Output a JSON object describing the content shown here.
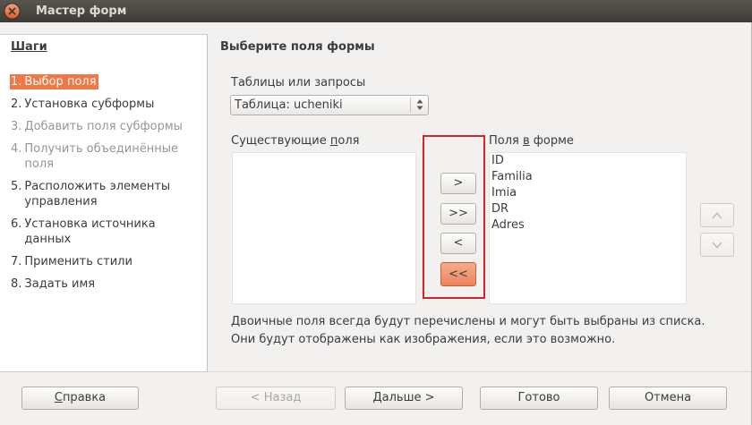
{
  "window": {
    "title": "Мастер форм",
    "close_icon": "close-icon"
  },
  "colors": {
    "accent": "#f07746",
    "annotation": "#d42426",
    "disabled_text": "#979592"
  },
  "steps": {
    "heading": "Шаги",
    "items": [
      {
        "number": "1.",
        "lines": [
          "Выбор поля"
        ],
        "selected": true,
        "enabled": true
      },
      {
        "number": "2.",
        "lines": [
          "Установка субформы"
        ],
        "selected": false,
        "enabled": true
      },
      {
        "number": "3.",
        "lines": [
          "Добавить поля субформы"
        ],
        "selected": false,
        "enabled": false
      },
      {
        "number": "4.",
        "lines": [
          "Получить объединённые",
          "поля"
        ],
        "selected": false,
        "enabled": false
      },
      {
        "number": "5.",
        "lines": [
          "Расположить элементы",
          "управления"
        ],
        "selected": false,
        "enabled": true
      },
      {
        "number": "6.",
        "lines": [
          "Установка источника",
          "данных"
        ],
        "selected": false,
        "enabled": true
      },
      {
        "number": "7.",
        "lines": [
          "Применить стили"
        ],
        "selected": false,
        "enabled": true
      },
      {
        "number": "8.",
        "lines": [
          "Задать имя"
        ],
        "selected": false,
        "enabled": true
      }
    ]
  },
  "page": {
    "title": "Выберите поля формы",
    "tables_label": "Таблицы или запросы",
    "table_select": {
      "value": "Таблица: ucheniki",
      "icon": "combo-arrows-icon"
    },
    "existing_fields": {
      "label_before": "Существующие ",
      "label_key": "п",
      "label_after": "оля",
      "items": []
    },
    "form_fields": {
      "label_before": "Поля ",
      "label_key": "в",
      "label_after": " форме",
      "items": [
        "ID",
        "Familia",
        "Imia",
        "DR",
        "Adres"
      ]
    },
    "transfer_buttons": {
      "add": ">",
      "add_all": ">>",
      "remove": "<",
      "remove_all": "<<"
    },
    "order_buttons": {
      "up_icon": "chevron-up-icon",
      "down_icon": "chevron-down-icon"
    },
    "note_lines": [
      "Двоичные поля всегда будут перечислены и могут быть выбраны из списка.",
      "Они будут отображены как изображения, если это возможно."
    ]
  },
  "footer": {
    "help": {
      "key": "С",
      "rest": "правка"
    },
    "back": "< Назад",
    "next": "Дальше >",
    "finish": "Готово",
    "cancel": "Отмена"
  }
}
